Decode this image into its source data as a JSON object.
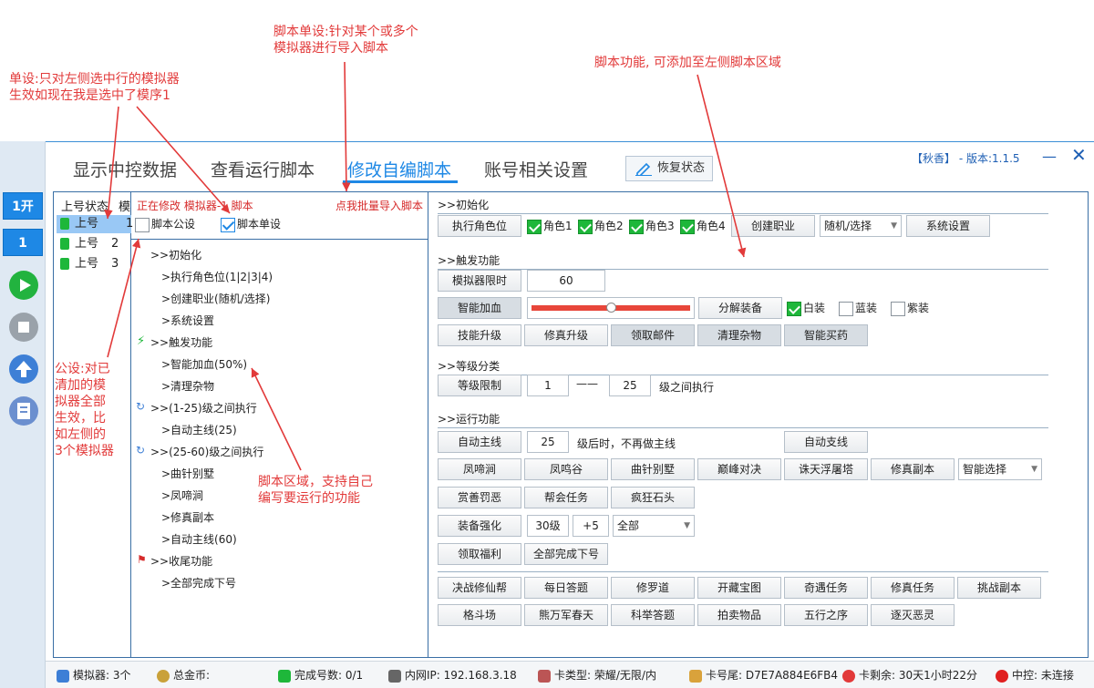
{
  "annotations": {
    "single": "单设:只对左侧选中行的模拟器\n生效如现在我是选中了模序1",
    "script_single": "脚本单设:针对某个或多个\n模拟器进行导入脚本",
    "script_func": "脚本功能, 可添加至左侧脚本区域",
    "public": "公设:对已\n清加的模\n拟器全部\n生效，比\n如左侧的\n3个模拟器",
    "script_area": "脚本区域，支持自己\n编写要运行的功能"
  },
  "sidebar": {
    "open_label": "1开",
    "count_label": "1"
  },
  "tabs": [
    "显示中控数据",
    "查看运行脚本",
    "修改自编脚本",
    "账号相关设置"
  ],
  "restore_label": "恢复状态",
  "window_title": "【秋香】 - 版本:1.1.5",
  "list": {
    "headers": [
      "上号状态",
      "模"
    ],
    "rows": [
      {
        "label": "上号",
        "num": "1"
      },
      {
        "label": "上号",
        "num": "2"
      },
      {
        "label": "上号",
        "num": "3"
      }
    ]
  },
  "editing": {
    "status": "正在修改 模拟器-1 脚本",
    "batch_import": "点我批量导入脚本",
    "public_label": "脚本公设",
    "single_label": "脚本单设"
  },
  "tree": [
    ">>初始化",
    ">执行角色位(1|2|3|4)",
    ">创建职业(随机/选择)",
    ">系统设置",
    ">>触发功能",
    ">智能加血(50%)",
    ">清理杂物",
    ">>(1-25)级之间执行",
    ">自动主线(25)",
    ">>(25-60)级之间执行",
    ">曲针别墅",
    ">凤啼涧",
    ">修真副本",
    ">自动主线(60)",
    ">>收尾功能",
    ">全部完成下号"
  ],
  "right": {
    "sec_init": ">>初始化",
    "exec_role": "执行角色位",
    "roles": [
      "角色1",
      "角色2",
      "角色3",
      "角色4"
    ],
    "create_job": "创建职业",
    "job_select": "随机/选择",
    "system_settings": "系统设置",
    "sec_trigger": ">>触发功能",
    "sim_limit": "模拟器限时",
    "sim_limit_value": "60",
    "smart_heal": "智能加血",
    "smart_heal_level": 0.5,
    "decompose": "分解装备",
    "quality": [
      "白装",
      "蓝装",
      "紫装"
    ],
    "trigger_btns": [
      "技能升级",
      "修真升级",
      "领取邮件",
      "清理杂物",
      "智能买药"
    ],
    "sec_level": ">>等级分类",
    "level_limit": "等级限制",
    "level_from": "1",
    "level_dash": "——",
    "level_to": "25",
    "level_between": "级之间执行",
    "sec_run": ">>运行功能",
    "auto_main": "自动主线",
    "auto_main_value": "25",
    "auto_main_note": "级后时，不再做主线",
    "auto_branch": "自动支线",
    "run_row2": [
      "凤啼涧",
      "凤鸣谷",
      "曲针别墅",
      "巅峰对决",
      "诛天浮屠塔",
      "修真副本"
    ],
    "smart_choice": "智能选择",
    "run_row3": [
      "赏善罚恶",
      "帮会任务",
      "疯狂石头"
    ],
    "equip_enhance": "装备强化",
    "equip_level": "30级",
    "equip_plus": "+5",
    "equip_all": "全部",
    "run_row5": [
      "领取福利",
      "全部完成下号"
    ],
    "grid_row1": [
      "决战修仙帮",
      "每日答题",
      "修罗道",
      "开藏宝图",
      "奇遇任务",
      "修真任务",
      "挑战副本"
    ],
    "grid_row2": [
      "格斗场",
      "熊万军春天",
      "科举答题",
      "拍卖物品",
      "五行之序",
      "逐灭恶灵"
    ]
  },
  "status": {
    "simulators": "模拟器: 3个",
    "gold": "总金币:",
    "done": "完成号数: 0/1",
    "ip": "内网IP: 192.168.3.18",
    "card_type": "卡类型: 荣耀/无限/内",
    "card_tail": "卡号尾: D7E7A884E6FB4",
    "card_left": "卡剩余: 30天1小时22分",
    "control": "中控: 未连接"
  },
  "colors": {
    "accent": "#1e88e5",
    "note": "#e23a3a",
    "green": "#1eb73a"
  }
}
